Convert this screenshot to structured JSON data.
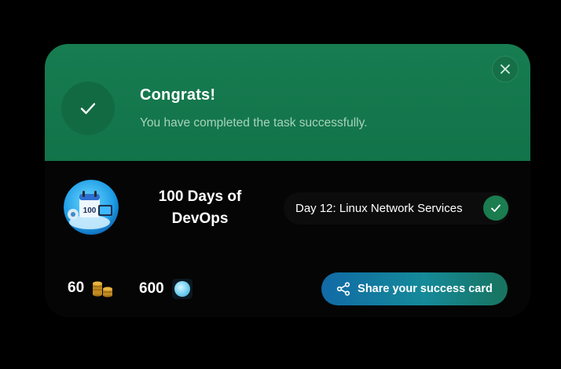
{
  "header": {
    "title": "Congrats!",
    "subtitle": "You have completed the task successfully.",
    "background_color": "#177c51",
    "icons": {
      "status": "check-icon",
      "close": "close-icon"
    }
  },
  "course": {
    "name_line1": "100 Days of",
    "name_line2": "DevOps",
    "image_icon": "devops-calendar-badge"
  },
  "task": {
    "label": "Day 12: Linux Network Services",
    "status_icon": "check-icon"
  },
  "rewards": {
    "coins": "60",
    "coins_icon": "coin-stack-icon",
    "gems": "600",
    "gems_icon": "gem-icon"
  },
  "share": {
    "label": "Share your success card",
    "icon": "share-icon"
  }
}
